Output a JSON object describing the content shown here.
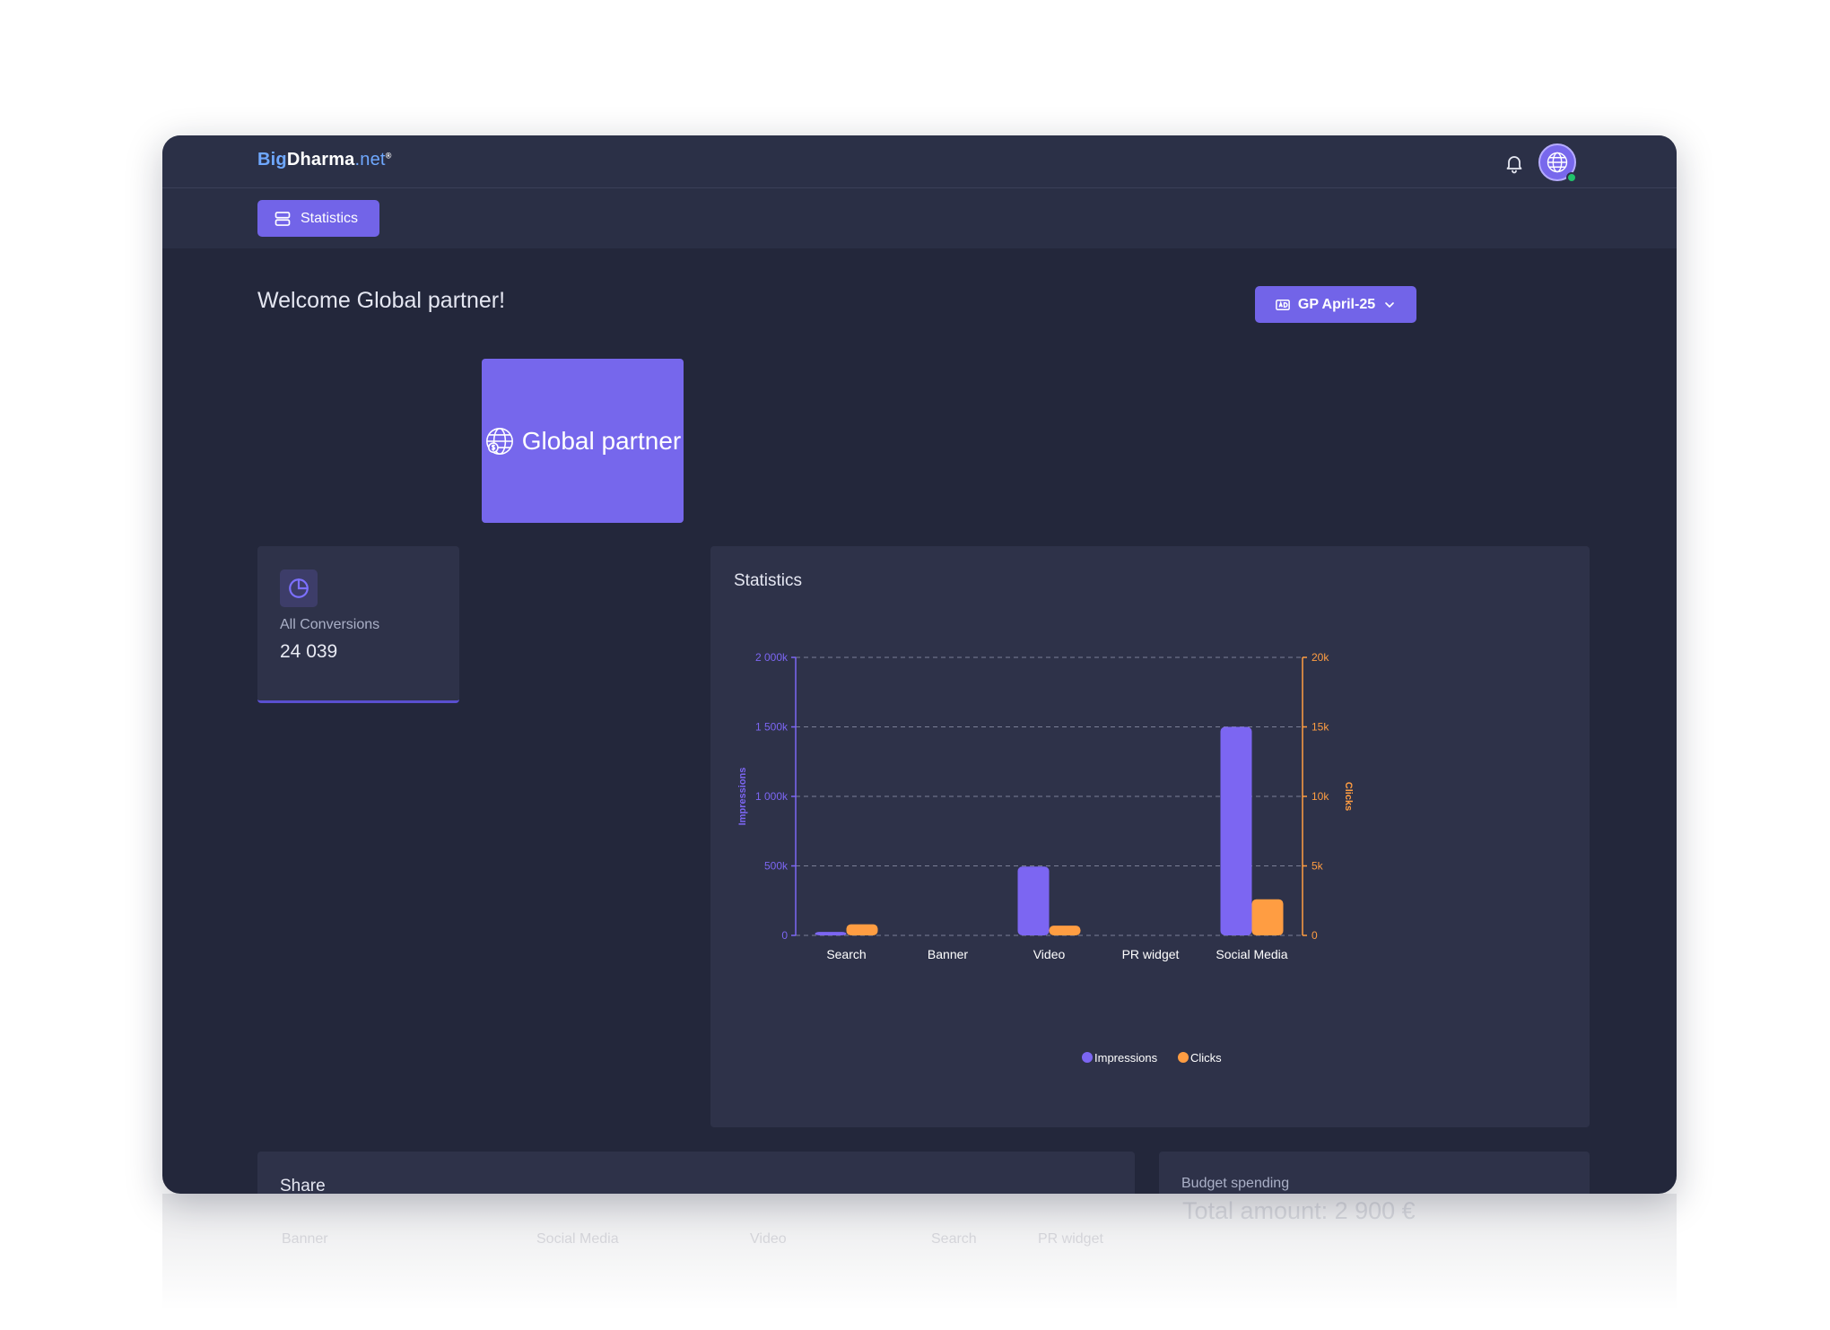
{
  "app": {
    "logo_part1": "Big",
    "logo_part2": "Dharma",
    "logo_part3": ".net",
    "logo_mark": "®",
    "bell_icon": "bell-icon",
    "avatar_icon": "globe-icon",
    "status": "online"
  },
  "nav": {
    "tab_label": "Statistics",
    "tab_icon": "server-icon"
  },
  "page": {
    "welcome": "Welcome Global partner!",
    "period_label": "GP April-25",
    "period_icon": "ad-icon"
  },
  "partner": {
    "name": "Global partner"
  },
  "conversions": {
    "label": "All Conversions",
    "value": "24 039",
    "icon": "pie-chart-icon"
  },
  "statistics": {
    "title": "Statistics"
  },
  "share": {
    "title": "Share",
    "columns": [
      "Banner",
      "Social Media",
      "Video",
      "Search",
      "PR widget"
    ]
  },
  "budget": {
    "label": "Budget spending",
    "total": "Total amount: 2 900 €"
  },
  "colors": {
    "accent": "#7264e8",
    "impressions": "#7c66f2",
    "clicks": "#ff9d42",
    "background": "#23273b",
    "card": "#2e3249"
  },
  "chart_data": {
    "type": "bar",
    "categories": [
      "Search",
      "Banner",
      "Video",
      "PR widget",
      "Social Media"
    ],
    "series": [
      {
        "name": "Impressions",
        "axis": "left",
        "color": "#7c66f2",
        "values": [
          25000,
          0,
          495000,
          0,
          1500000
        ]
      },
      {
        "name": "Clicks",
        "axis": "right",
        "color": "#ff9d42",
        "values": [
          800,
          0,
          700,
          0,
          2600
        ]
      }
    ],
    "ylabel": "Impressions",
    "ylabel_right": "Clicks",
    "ylim": [
      0,
      2000000
    ],
    "ylim_right": [
      0,
      20000
    ],
    "yticks": [
      "0",
      "500k",
      "1 000k",
      "1 500k",
      "2 000k"
    ],
    "yticks_right": [
      "0",
      "5k",
      "10k",
      "15k",
      "20k"
    ],
    "grid": true,
    "legend": "bottom-center"
  }
}
